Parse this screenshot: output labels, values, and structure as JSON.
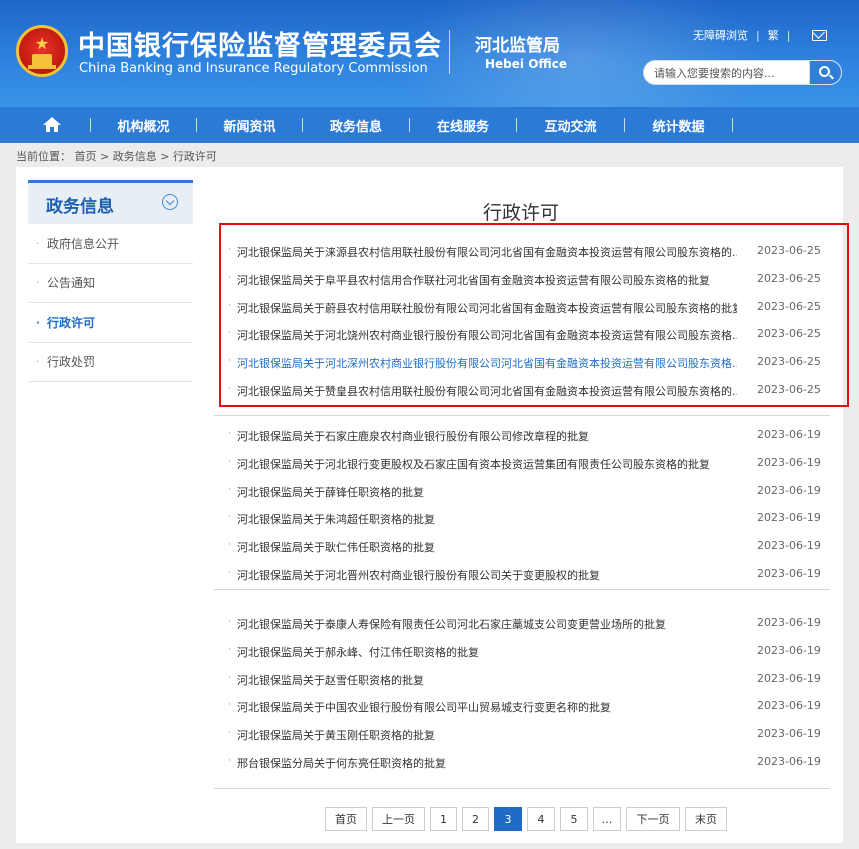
{
  "header": {
    "title_cn": "中国银行保险监督管理委员会",
    "title_en": "China Banking and Insurance Regulatory Commission",
    "office_cn": "河北监管局",
    "office_en": "Hebei Office",
    "links": [
      "无障碍浏览",
      "繁"
    ],
    "search_placeholder": "请输入您要搜索的内容..."
  },
  "nav": {
    "items": [
      "机构概况",
      "新闻资讯",
      "政务信息",
      "在线服务",
      "互动交流",
      "统计数据"
    ]
  },
  "breadcrumb": "当前位置： 首页 > 政务信息 > 行政许可",
  "sidebar": {
    "title": "政务信息",
    "items": [
      {
        "label": "政府信息公开"
      },
      {
        "label": "公告通知"
      },
      {
        "label": "行政许可"
      },
      {
        "label": "行政处罚"
      }
    ]
  },
  "main": {
    "title": "行政许可",
    "groups": [
      [
        {
          "title": "河北银保监局关于涞源县农村信用联社股份有限公司河北省国有金融资本投资运营有限公司股东资格的...",
          "date": "2023-06-25"
        },
        {
          "title": "河北银保监局关于阜平县农村信用合作联社河北省国有金融资本投资运营有限公司股东资格的批复",
          "date": "2023-06-25"
        },
        {
          "title": "河北银保监局关于蔚县农村信用联社股份有限公司河北省国有金融资本投资运营有限公司股东资格的批复",
          "date": "2023-06-25"
        },
        {
          "title": "河北银保监局关于河北饶州农村商业银行股份有限公司河北省国有金融资本投资运营有限公司股东资格...",
          "date": "2023-06-25"
        },
        {
          "title": "河北银保监局关于河北深州农村商业银行股份有限公司河北省国有金融资本投资运营有限公司股东资格...",
          "date": "2023-06-25"
        },
        {
          "title": "河北银保监局关于赞皇县农村信用联社股份有限公司河北省国有金融资本投资运营有限公司股东资格的...",
          "date": "2023-06-25"
        }
      ],
      [
        {
          "title": "河北银保监局关于石家庄鹿泉农村商业银行股份有限公司修改章程的批复",
          "date": "2023-06-19"
        },
        {
          "title": "河北银保监局关于河北银行变更股权及石家庄国有资本投资运营集团有限责任公司股东资格的批复",
          "date": "2023-06-19"
        },
        {
          "title": "河北银保监局关于薛锋任职资格的批复",
          "date": "2023-06-19"
        },
        {
          "title": "河北银保监局关于朱鸿超任职资格的批复",
          "date": "2023-06-19"
        },
        {
          "title": "河北银保监局关于耿仁伟任职资格的批复",
          "date": "2023-06-19"
        },
        {
          "title": "河北银保监局关于河北晋州农村商业银行股份有限公司关于变更股权的批复",
          "date": "2023-06-19"
        }
      ],
      [
        {
          "title": "河北银保监局关于泰康人寿保险有限责任公司河北石家庄藁城支公司变更营业场所的批复",
          "date": "2023-06-19"
        },
        {
          "title": "河北银保监局关于郝永峰、付江伟任职资格的批复",
          "date": "2023-06-19"
        },
        {
          "title": "河北银保监局关于赵雪任职资格的批复",
          "date": "2023-06-19"
        },
        {
          "title": "河北银保监局关于中国农业银行股份有限公司平山贸易城支行变更名称的批复",
          "date": "2023-06-19"
        },
        {
          "title": "河北银保监局关于黄玉刚任职资格的批复",
          "date": "2023-06-19"
        },
        {
          "title": "邢台银保监分局关于何东亮任职资格的批复",
          "date": "2023-06-19"
        }
      ]
    ]
  },
  "pagination": {
    "items": [
      "首页",
      "上一页",
      "1",
      "2",
      "3",
      "4",
      "5",
      "...",
      "下一页",
      "末页"
    ],
    "current": "3"
  }
}
